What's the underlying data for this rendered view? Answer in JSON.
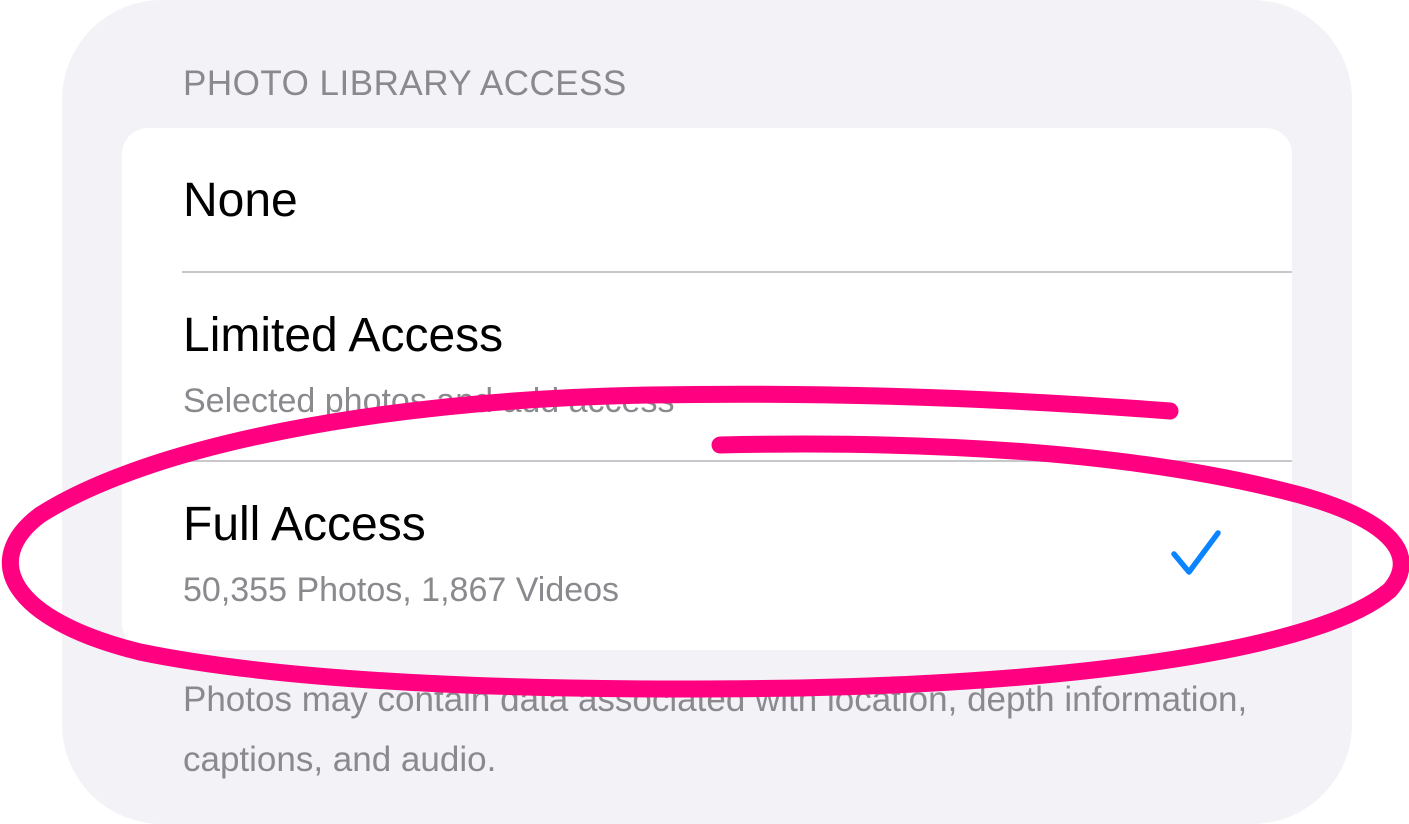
{
  "section": {
    "header": "PHOTO LIBRARY ACCESS"
  },
  "options": [
    {
      "title": "None",
      "subtitle": "",
      "selected": false
    },
    {
      "title": "Limited Access",
      "subtitle": "Selected photos and add access",
      "selected": false
    },
    {
      "title": "Full Access",
      "subtitle": "50,355 Photos, 1,867 Videos",
      "selected": true
    }
  ],
  "footer": {
    "text": "Photos may contain data associated with location, depth information, captions, and audio."
  },
  "icons": {
    "selected_marker": "checkmark-icon"
  },
  "colors": {
    "accent": "#0a84ff",
    "annotation": "#ff0080",
    "panel_background": "#f2f2f7",
    "card_background": "#ffffff",
    "secondary_text": "#8a8a8e"
  }
}
